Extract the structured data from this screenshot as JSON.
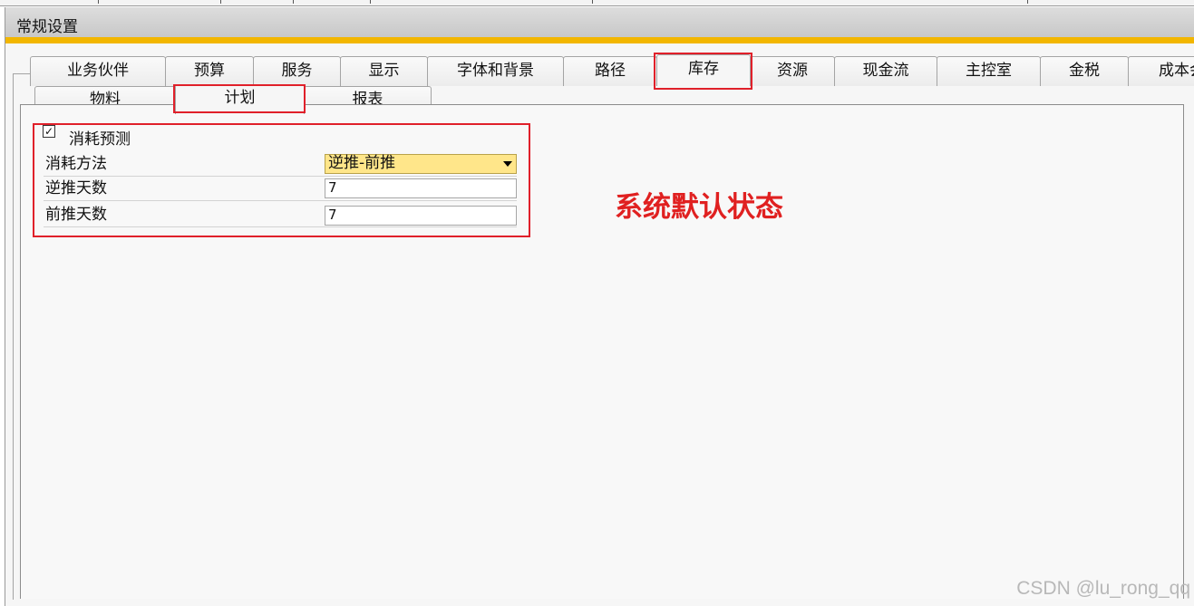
{
  "window": {
    "title": "常规设置"
  },
  "main_tabs": [
    {
      "label": "业务伙伴"
    },
    {
      "label": "预算"
    },
    {
      "label": "服务"
    },
    {
      "label": "显示"
    },
    {
      "label": "字体和背景"
    },
    {
      "label": "路径"
    },
    {
      "label": "库存",
      "active": true
    },
    {
      "label": "资源"
    },
    {
      "label": "现金流"
    },
    {
      "label": "主控室"
    },
    {
      "label": "金税"
    },
    {
      "label": "成本会"
    }
  ],
  "sub_tabs": [
    {
      "label": "物料"
    },
    {
      "label": "计划",
      "active": true
    },
    {
      "label": "报表"
    }
  ],
  "form": {
    "consumption_forecast": {
      "label": "消耗预测",
      "checked": true,
      "check_glyph": "✓"
    },
    "consumption_method": {
      "label": "消耗方法",
      "value": "逆推-前推"
    },
    "backward_days": {
      "label": "逆推天数",
      "value": "7"
    },
    "forward_days": {
      "label": "前推天数",
      "value": "7"
    }
  },
  "annotation": {
    "text": "系统默认状态",
    "color": "#e02020"
  },
  "watermark": "CSDN @lu_rong_qq",
  "colors": {
    "accent": "#f2b600",
    "highlight_box": "#e0202a",
    "select_bg": "#ffe68a"
  }
}
